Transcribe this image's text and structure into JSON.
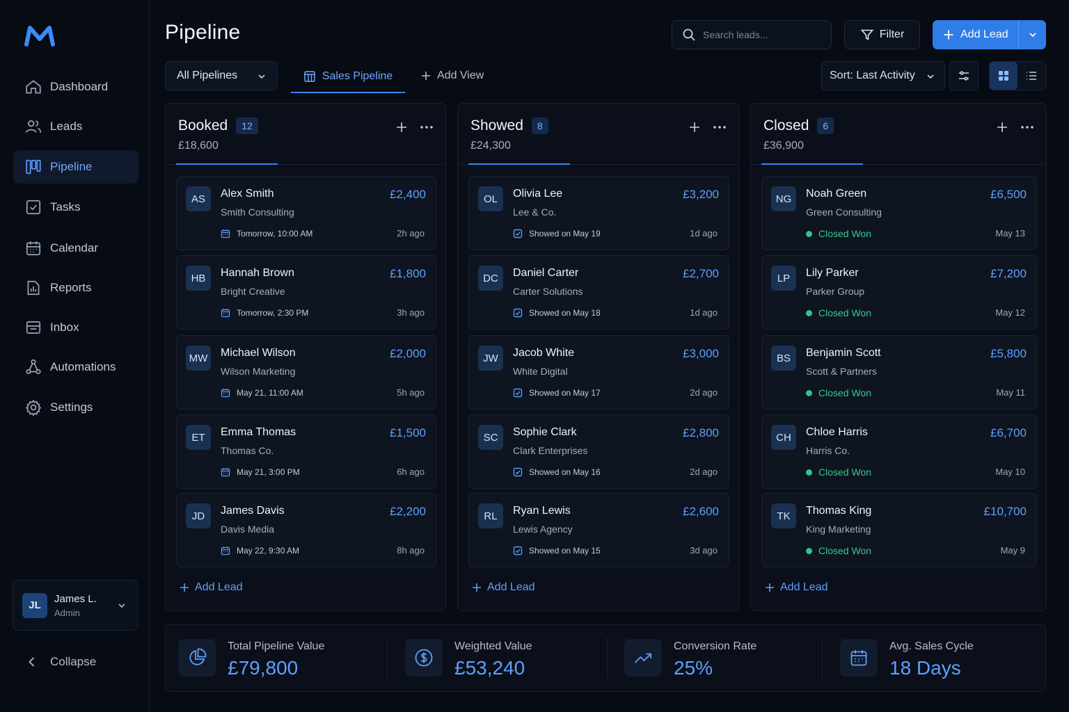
{
  "app": {
    "page_title": "Pipeline"
  },
  "sidebar": {
    "items": [
      {
        "label": "Dashboard",
        "icon": "home-icon"
      },
      {
        "label": "Leads",
        "icon": "users-icon"
      },
      {
        "label": "Pipeline",
        "icon": "kanban-icon",
        "active": true
      },
      {
        "label": "Tasks",
        "icon": "checkbox-icon"
      },
      {
        "label": "Calendar",
        "icon": "calendar-icon"
      },
      {
        "label": "Reports",
        "icon": "reports-icon"
      },
      {
        "label": "Inbox",
        "icon": "inbox-icon"
      },
      {
        "label": "Automations",
        "icon": "automations-icon"
      },
      {
        "label": "Settings",
        "icon": "gear-icon"
      }
    ],
    "user": {
      "initials": "JL",
      "name": "James L.",
      "role": "Admin"
    },
    "collapse_label": "Collapse"
  },
  "header": {
    "search_placeholder": "Search leads...",
    "filter_label": "Filter",
    "add_lead_label": "Add Lead"
  },
  "toolbar": {
    "pipeline_select": "All Pipelines",
    "active_tab": "Sales Pipeline",
    "add_view_label": "Add View",
    "sort_label": "Sort: Last Activity",
    "view_mode": "board"
  },
  "columns": [
    {
      "title": "Booked",
      "count": "12",
      "total": "£18,600",
      "add_lead_label": "Add Lead",
      "cards": [
        {
          "initials": "AS",
          "name": "Alex Smith",
          "company": "Smith Consulting",
          "amount": "£2,400",
          "meta": "Tomorrow, 10:00 AM",
          "time": "2h ago"
        },
        {
          "initials": "HB",
          "name": "Hannah Brown",
          "company": "Bright Creative",
          "amount": "£1,800",
          "meta": "Tomorrow, 2:30 PM",
          "time": "3h ago"
        },
        {
          "initials": "MW",
          "name": "Michael Wilson",
          "company": "Wilson Marketing",
          "amount": "£2,000",
          "meta": "May 21, 11:00 AM",
          "time": "5h ago"
        },
        {
          "initials": "ET",
          "name": "Emma Thomas",
          "company": "Thomas Co.",
          "amount": "£1,500",
          "meta": "May 21, 3:00 PM",
          "time": "6h ago"
        },
        {
          "initials": "JD",
          "name": "James Davis",
          "company": "Davis Media",
          "amount": "£2,200",
          "meta": "May 22, 9:30 AM",
          "time": "8h ago"
        }
      ]
    },
    {
      "title": "Showed",
      "count": "8",
      "total": "£24,300",
      "add_lead_label": "Add Lead",
      "cards": [
        {
          "initials": "OL",
          "name": "Olivia Lee",
          "company": "Lee & Co.",
          "amount": "£3,200",
          "meta": "Showed on May 19",
          "time": "1d ago"
        },
        {
          "initials": "DC",
          "name": "Daniel Carter",
          "company": "Carter Solutions",
          "amount": "£2,700",
          "meta": "Showed on May 18",
          "time": "1d ago"
        },
        {
          "initials": "JW",
          "name": "Jacob White",
          "company": "White Digital",
          "amount": "£3,000",
          "meta": "Showed on May 17",
          "time": "2d ago"
        },
        {
          "initials": "SC",
          "name": "Sophie Clark",
          "company": "Clark Enterprises",
          "amount": "£2,800",
          "meta": "Showed on May 16",
          "time": "2d ago"
        },
        {
          "initials": "RL",
          "name": "Ryan Lewis",
          "company": "Lewis Agency",
          "amount": "£2,600",
          "meta": "Showed on May 15",
          "time": "3d ago"
        }
      ]
    },
    {
      "title": "Closed",
      "count": "6",
      "total": "£36,900",
      "add_lead_label": "Add Lead",
      "cards": [
        {
          "initials": "NG",
          "name": "Noah Green",
          "company": "Green Consulting",
          "amount": "£6,500",
          "meta": "Closed Won",
          "time": "May 13"
        },
        {
          "initials": "LP",
          "name": "Lily Parker",
          "company": "Parker Group",
          "amount": "£7,200",
          "meta": "Closed Won",
          "time": "May 12"
        },
        {
          "initials": "BS",
          "name": "Benjamin Scott",
          "company": "Scott & Partners",
          "amount": "£5,800",
          "meta": "Closed Won",
          "time": "May 11"
        },
        {
          "initials": "CH",
          "name": "Chloe Harris",
          "company": "Harris Co.",
          "amount": "£6,700",
          "meta": "Closed Won",
          "time": "May 10"
        },
        {
          "initials": "TK",
          "name": "Thomas King",
          "company": "King Marketing",
          "amount": "£10,700",
          "meta": "Closed Won",
          "time": "May 9"
        }
      ]
    }
  ],
  "stats": [
    {
      "label": "Total Pipeline Value",
      "value": "£79,800",
      "icon": "pie-chart-icon"
    },
    {
      "label": "Weighted Value",
      "value": "£53,240",
      "icon": "dollar-circle-icon"
    },
    {
      "label": "Conversion Rate",
      "value": "25%",
      "icon": "trend-up-icon"
    },
    {
      "label": "Avg. Sales Cycle",
      "value": "18 Days",
      "icon": "calendar-icon"
    }
  ],
  "colors": {
    "accent": "#2f7de9",
    "accent_text": "#5ea0ff",
    "success": "#2fc58c",
    "background": "#070b14",
    "panel": "#0a0f1a"
  }
}
